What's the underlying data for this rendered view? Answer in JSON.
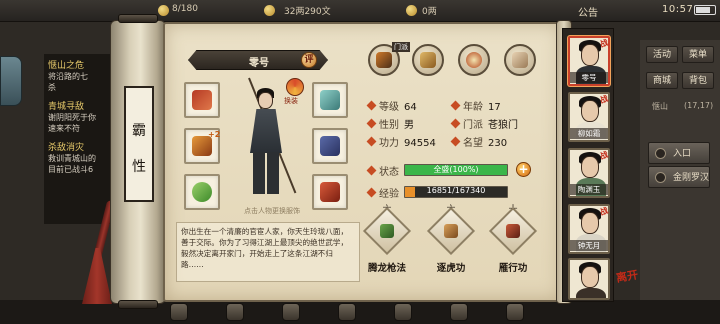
{
  "topbar": {
    "stamina": "8/180",
    "money": "32两290文",
    "currency": "0两",
    "announcement": "公告",
    "time": "10:57"
  },
  "quests": [
    {
      "title": "惬山之危",
      "lines": [
        "将沿路的七",
        "杀"
      ]
    },
    {
      "title": "青城寻敌",
      "lines": [
        "谢阴阳死于你",
        "速来不符"
      ]
    },
    {
      "title": "杀敌消灾",
      "lines": [
        "救训青城山的",
        "目前已战斗6"
      ]
    }
  ],
  "right_menu": {
    "buttons": [
      "活动",
      "菜单",
      "商城",
      "背包"
    ],
    "location": "惬山",
    "coords": "(17,17)",
    "entrance": "入口",
    "shop": "金刚罗汉"
  },
  "scroll": {
    "plaque": [
      "霸",
      "性"
    ]
  },
  "character": {
    "name": "零号",
    "eval_badge": "评",
    "swap_label": "换装",
    "click_hint": "点击人物更换服饰",
    "equip_plus": "+2",
    "bio": "你出生在一个清廉的官宦人家，你天生玲珑八面，善于交际。你为了习得江湖上最顶尖的绝世武学，毅然决定离开家门，开始走上了这条江湖不归路……"
  },
  "stats": {
    "level_label": "等级",
    "level": "64",
    "age_label": "年龄",
    "age": "17",
    "gender_label": "性别",
    "gender": "男",
    "sect_label": "门派",
    "sect": "苍狼门",
    "power_label": "功力",
    "power": "94554",
    "fame_label": "名望",
    "fame": "230",
    "status_label": "状态",
    "status_text": "全盛(100%)",
    "status_fraction": 1.0,
    "exp_label": "经验",
    "exp_text": "16851/167340",
    "exp_fraction": 0.1007,
    "sect_lock": "门派"
  },
  "skills": [
    {
      "name": "腾龙枪法",
      "level": "六"
    },
    {
      "name": "逐虎功",
      "level": "六"
    },
    {
      "name": "雁行功",
      "level": "十"
    }
  ],
  "party": [
    {
      "name": "零号",
      "active": true
    },
    {
      "name": "柳如霜",
      "active": false
    },
    {
      "name": "陶渊玉",
      "active": false
    },
    {
      "name": "钟无月",
      "active": false
    },
    {
      "name": "",
      "active": false
    }
  ],
  "party_badge": "战",
  "bottom_mark": "离开",
  "colors": {
    "status_fill": "#3bb64a",
    "exp_fill": "#e8902a",
    "accent_red": "#c32a18"
  }
}
